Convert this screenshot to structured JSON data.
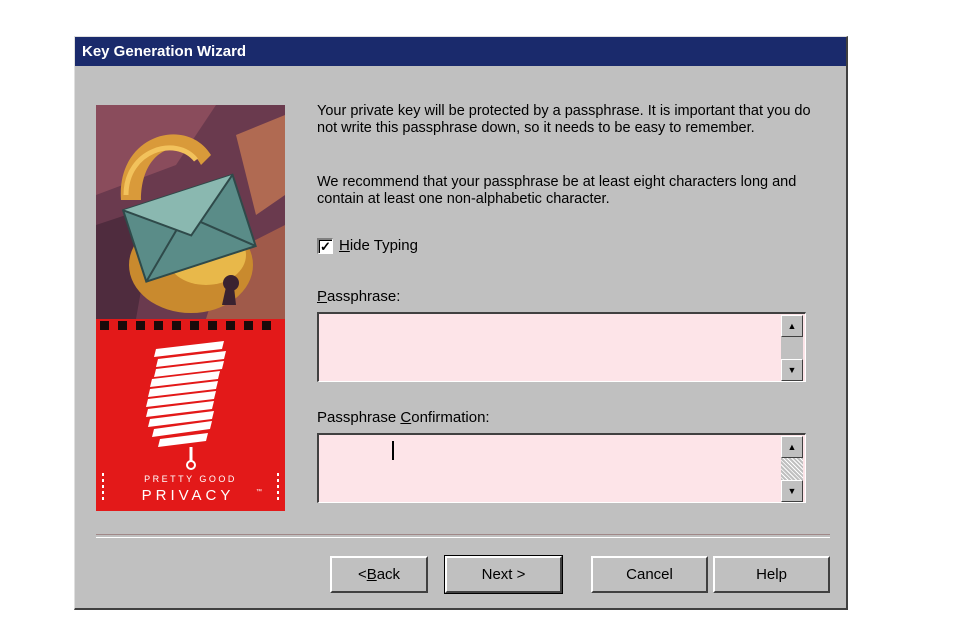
{
  "window": {
    "title": "Key Generation Wizard"
  },
  "intro": {
    "paragraph1": "Your private key will be protected by a passphrase.  It is important that you do not write this passphrase down, so it needs to be easy to remember.",
    "paragraph2": "We recommend that your passphrase be at least eight characters long and contain at least one non-alphabetic character."
  },
  "hide_typing": {
    "label_accel": "H",
    "label_rest": "ide Typing",
    "checked": true,
    "check_glyph": "✓"
  },
  "passphrase": {
    "label_accel": "P",
    "label_rest": "assphrase:",
    "value": ""
  },
  "confirmation": {
    "label_before": "Passphrase ",
    "label_accel": "C",
    "label_rest": "onfirmation:",
    "value": ""
  },
  "sidebar": {
    "brand_line1": "PRETTY GOOD",
    "brand_line2": "PRIVACY",
    "trademark": "™"
  },
  "buttons": {
    "back_prefix": "< ",
    "back_accel": "B",
    "back_rest": "ack",
    "next": "Next >",
    "cancel": "Cancel",
    "help": "Help"
  },
  "colors": {
    "titlebar": "#1a2a6c",
    "dialog": "#c0c0c0",
    "field_bg": "#fde4e8",
    "brand_red": "#e31919"
  },
  "icons": {
    "scroll_up": "▲",
    "scroll_down": "▼"
  }
}
